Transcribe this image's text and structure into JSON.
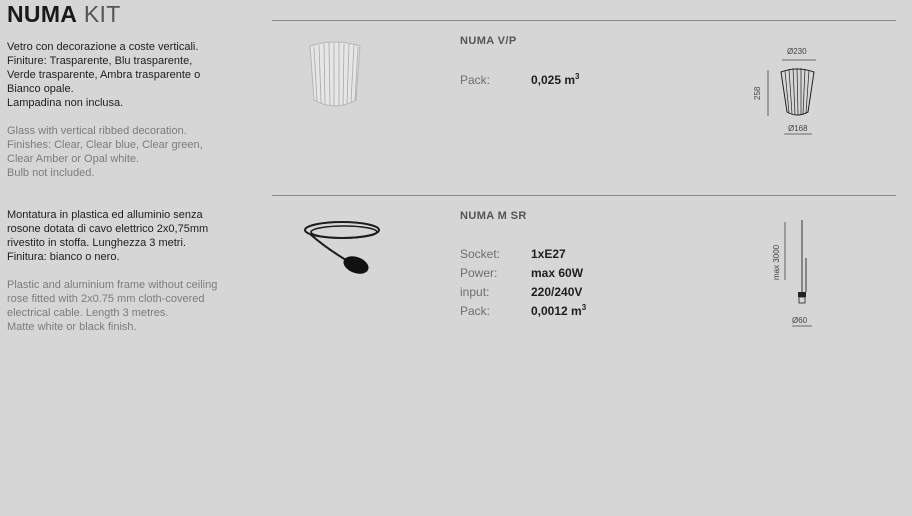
{
  "header": {
    "brand": "NUMA",
    "subtitle": "KIT"
  },
  "section1": {
    "it_lines": [
      "Vetro con decorazione a coste verticali.",
      "Finiture: Trasparente, Blu trasparente,",
      "Verde trasparente, Ambra trasparente o",
      "Bianco opale.",
      "Lampadina non inclusa."
    ],
    "en_lines": [
      "Glass with vertical ribbed decoration.",
      "Finishes: Clear, Clear blue, Clear green,",
      "Clear Amber or Opal white.",
      "Bulb not included."
    ],
    "product": {
      "name": "NUMA V/P",
      "specs": [
        {
          "label": "Pack:",
          "value": "0,025 m",
          "sup": "3"
        }
      ],
      "dims": {
        "top": "Ø230",
        "height": "258",
        "bottom": "Ø168"
      }
    }
  },
  "section2": {
    "it_lines": [
      "Montatura in plastica ed alluminio senza",
      "rosone dotata di cavo elettrico 2x0,75mm",
      "rivestito in stoffa. Lunghezza 3 metri.",
      "Finitura: bianco o nero."
    ],
    "en_lines": [
      "Plastic and aluminium frame without ceiling",
      "rose fitted with 2x0.75 mm cloth-covered",
      "electrical cable. Length 3 metres.",
      "Matte white or black finish."
    ],
    "product": {
      "name": "NUMA M SR",
      "specs": [
        {
          "label": "Socket:",
          "value": "1xE27",
          "sup": ""
        },
        {
          "label": "Power:",
          "value": "max 60W",
          "sup": ""
        },
        {
          "label": "input:",
          "value": "220/240V",
          "sup": ""
        },
        {
          "label": "Pack:",
          "value": "0,0012 m",
          "sup": "3"
        }
      ],
      "dims": {
        "length": "max 3000",
        "bottom": "Ø60"
      }
    }
  },
  "colors": {
    "background": "#d6d6d7",
    "rule": "#8a8a8a",
    "text": "#1e1e1e",
    "muted": "#7c7c7c"
  }
}
